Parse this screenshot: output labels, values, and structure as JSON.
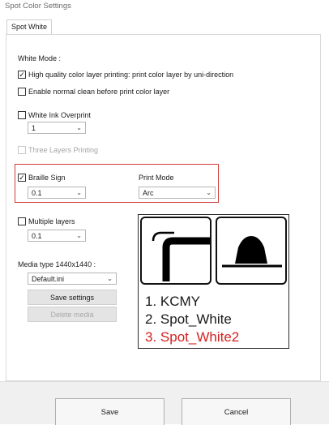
{
  "window": {
    "title": "Spot Color Settings"
  },
  "tabs": [
    {
      "label": "Spot White"
    }
  ],
  "white_mode": {
    "label": "White Mode :",
    "high_quality": {
      "label": "High quality color layer printing: print color layer by uni-direction",
      "checked": true
    },
    "enable_clean": {
      "label": "Enable normal clean before print color layer",
      "checked": false
    }
  },
  "white_ink_overprint": {
    "label": "White Ink Overprint",
    "checked": false,
    "value": "1"
  },
  "three_layers": {
    "label": "Three Layers Printing",
    "checked": false,
    "disabled": true
  },
  "braille": {
    "label": "Braille Sign",
    "checked": true,
    "value": "0.1"
  },
  "print_mode": {
    "label": "Print Mode",
    "value": "Arc"
  },
  "multiple_layers": {
    "label": "Multiple layers",
    "checked": false,
    "value": "0.1"
  },
  "media": {
    "label": "Media type 1440x1440 :",
    "value": "Default.ini",
    "save_label": "Save settings",
    "delete_label": "Delete media"
  },
  "figure": {
    "items": [
      "1. KCMY",
      "2. Spot_White",
      "3. Spot_White2"
    ],
    "highlight_color": "#d42020"
  },
  "footer": {
    "save_label": "Save",
    "cancel_label": "Cancel"
  },
  "colors": {
    "highlight_border": "#d43a3a"
  }
}
